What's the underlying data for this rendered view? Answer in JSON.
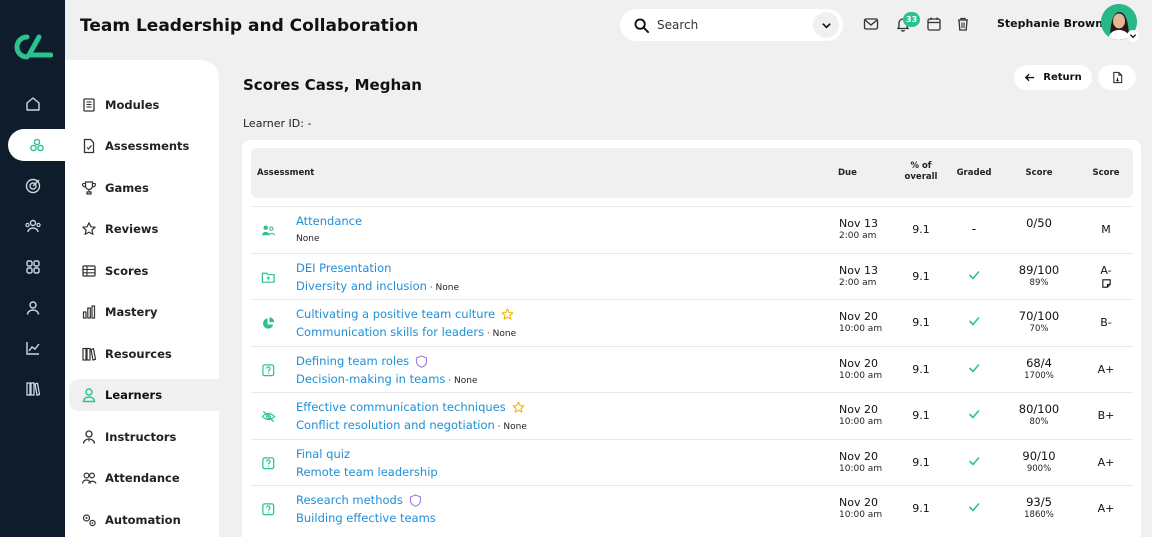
{
  "header": {
    "title": "Team Leadership and Collaboration",
    "search_placeholder": "Search",
    "notification_count": "33",
    "user_name": "Stephanie Brown"
  },
  "rail": {
    "items": [
      "home-icon",
      "modules-icon",
      "target-icon",
      "users-icon",
      "grid-icon",
      "user-icon",
      "chart-icon",
      "library-icon"
    ],
    "active_index": 1
  },
  "subnav": {
    "items": [
      {
        "label": "Modules",
        "icon": "book-icon"
      },
      {
        "label": "Assessments",
        "icon": "assessment-icon"
      },
      {
        "label": "Games",
        "icon": "trophy-icon"
      },
      {
        "label": "Reviews",
        "icon": "star-icon"
      },
      {
        "label": "Scores",
        "icon": "table-icon"
      },
      {
        "label": "Mastery",
        "icon": "bars-icon"
      },
      {
        "label": "Resources",
        "icon": "books-icon"
      },
      {
        "label": "Learners",
        "icon": "person-icon"
      },
      {
        "label": "Instructors",
        "icon": "instructor-icon"
      },
      {
        "label": "Attendance",
        "icon": "group-icon"
      },
      {
        "label": "Automation",
        "icon": "cogs-icon"
      }
    ],
    "active": "Learners"
  },
  "main": {
    "title": "Scores Cass, Meghan",
    "learner_id": "Learner ID: -",
    "return_label": "Return"
  },
  "table": {
    "headers": {
      "assessment": "Assessment",
      "due": "Due",
      "pct_l1": "% of",
      "pct_l2": "overall",
      "graded": "Graded",
      "score": "Score",
      "grade": "Score"
    },
    "rows": [
      {
        "icon": "attendance-icon",
        "title": "Attendance",
        "mark": "",
        "sub": "",
        "sub_note": "None",
        "due_date": "Nov 13",
        "due_time": "2:00 am",
        "pct": "9.1",
        "graded": "-",
        "score": "0/50",
        "score_pct": "",
        "grade": "M",
        "grade_note": false
      },
      {
        "icon": "folder-icon",
        "title": "DEI Presentation",
        "mark": "",
        "sub": "Diversity and inclusion",
        "sub_note": " · None",
        "due_date": "Nov 13",
        "due_time": "2:00 am",
        "pct": "9.1",
        "graded": "check",
        "score": "89/100",
        "score_pct": "89%",
        "grade": "A-",
        "grade_note": true
      },
      {
        "icon": "pie-icon",
        "title": "Cultivating a positive team culture",
        "mark": "star",
        "sub": "Communication skills for leaders",
        "sub_note": " · None",
        "due_date": "Nov 20",
        "due_time": "10:00 am",
        "pct": "9.1",
        "graded": "check",
        "score": "70/100",
        "score_pct": "70%",
        "grade": "B-",
        "grade_note": false
      },
      {
        "icon": "quiz-icon",
        "title": "Defining team roles",
        "mark": "shield",
        "sub": "Decision-making in teams",
        "sub_note": " · None",
        "due_date": "Nov 20",
        "due_time": "10:00 am",
        "pct": "9.1",
        "graded": "check",
        "score": "68/4",
        "score_pct": "1700%",
        "grade": "A+",
        "grade_note": false
      },
      {
        "icon": "eye-off-icon",
        "title": "Effective communication techniques",
        "mark": "star",
        "sub": "Conflict resolution and negotiation",
        "sub_note": " · None",
        "due_date": "Nov 20",
        "due_time": "10:00 am",
        "pct": "9.1",
        "graded": "check",
        "score": "80/100",
        "score_pct": "80%",
        "grade": "B+",
        "grade_note": false
      },
      {
        "icon": "quiz-icon",
        "title": "Final quiz",
        "mark": "",
        "sub": "Remote team leadership",
        "sub_note": "",
        "due_date": "Nov 20",
        "due_time": "10:00 am",
        "pct": "9.1",
        "graded": "check",
        "score": "90/10",
        "score_pct": "900%",
        "grade": "A+",
        "grade_note": false
      },
      {
        "icon": "quiz-icon",
        "title": "Research methods",
        "mark": "shield",
        "sub": "Building effective teams",
        "sub_note": "",
        "due_date": "Nov 20",
        "due_time": "10:00 am",
        "pct": "9.1",
        "graded": "check",
        "score": "93/5",
        "score_pct": "1860%",
        "grade": "A+",
        "grade_note": false
      }
    ]
  },
  "colors": {
    "rail_bg": "#0f1c2b",
    "accent": "#2bc28e",
    "link": "#1f8fd6",
    "star": "#f2b705",
    "shield": "#9b7ee0"
  }
}
